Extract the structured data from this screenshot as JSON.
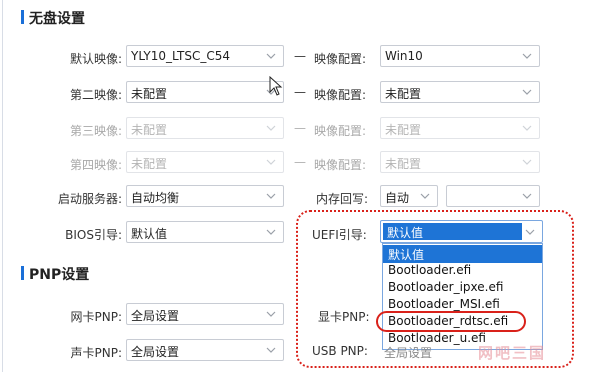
{
  "sections": {
    "diskless_title": "无盘设置",
    "pnp_title": "PNP设置"
  },
  "rows": {
    "default_image": {
      "label": "默认映像:",
      "value": "YLY10_LTSC_C54",
      "cfg_label": "映像配置:",
      "cfg_value": "Win10"
    },
    "second_image": {
      "label": "第二映像:",
      "value": "未配置",
      "cfg_label": "映像配置:",
      "cfg_value": "未配置"
    },
    "third_image": {
      "label": "第三映像:",
      "value": "未配置",
      "cfg_label": "映像配置:",
      "cfg_value": "未配置"
    },
    "fourth_image": {
      "label": "第四映像:",
      "value": "未配置",
      "cfg_label": "映像配置:",
      "cfg_value": "未配置"
    },
    "boot_server": {
      "label": "启动服务器:",
      "value": "自动均衡",
      "mem_label": "内存回写:",
      "mem_value": "自动",
      "mem_extra": ""
    },
    "bios_boot": {
      "label": "BIOS引导:",
      "value": "默认值",
      "uefi_label": "UEFI引导:",
      "uefi_value": "默认值"
    }
  },
  "dash": "—",
  "uefi_dropdown": {
    "options": [
      "默认值",
      "Bootloader.efi",
      "Bootloader_ipxe.efi",
      "Bootloader_MSI.efi",
      "Bootloader_rdtsc.efi",
      "Bootloader_u.efi"
    ],
    "selected_index": 0,
    "highlighted_option": "Bootloader_rdtsc.efi"
  },
  "pnp": {
    "nic": {
      "label": "网卡PNP:",
      "value": "全局设置",
      "right_label": "显卡PNP:"
    },
    "sound": {
      "label": "声卡PNP:",
      "value": "全局设置",
      "right_label": "USB PNP:",
      "right_value": "全局设置"
    }
  },
  "watermark": "网吧三国",
  "colors": {
    "accent": "#1a6fd8",
    "highlight_red": "#d9211a",
    "selected_bg": "#1e74d6"
  }
}
